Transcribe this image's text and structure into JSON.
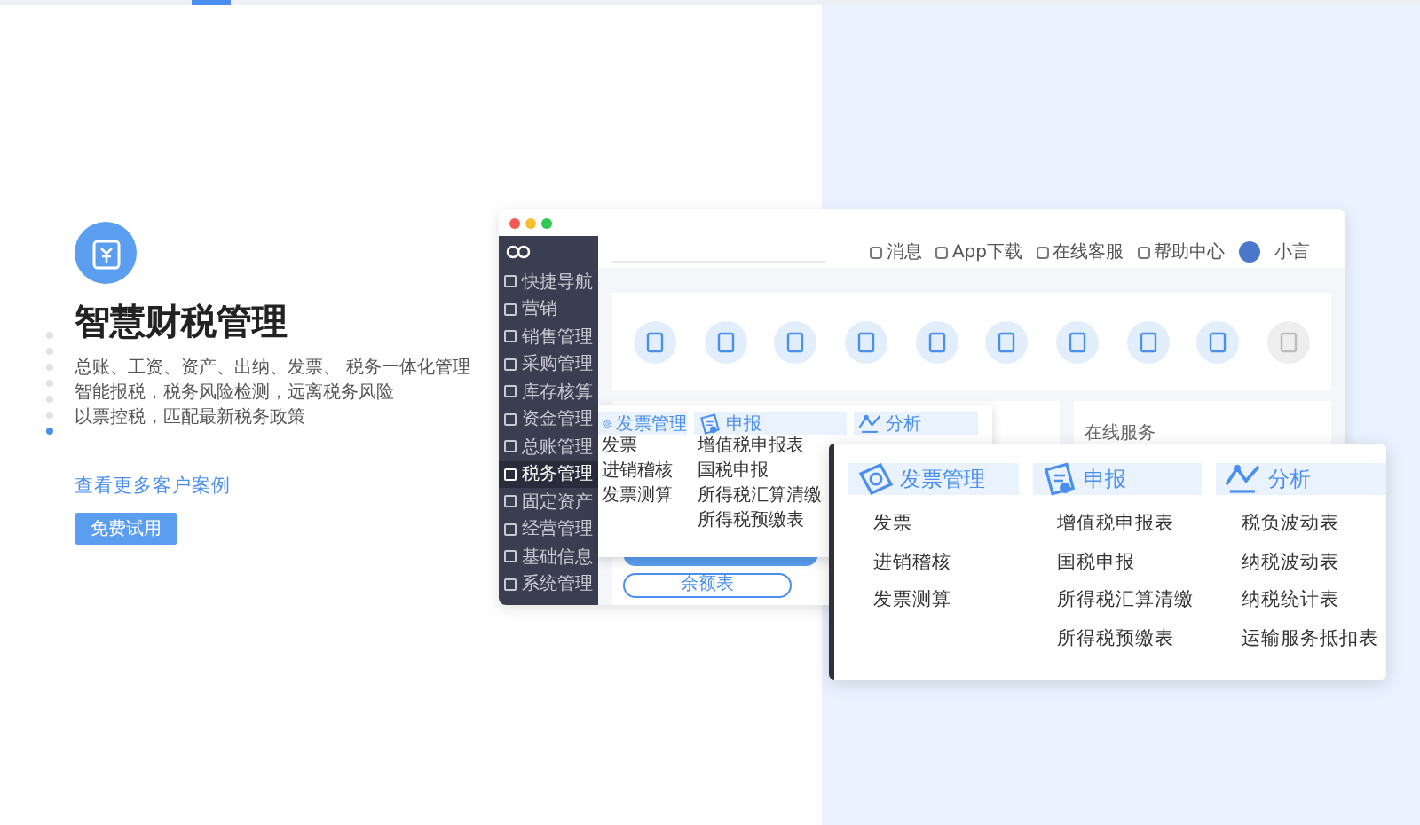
{
  "hero": {
    "title": "智慧财税管理",
    "lines": [
      "总账、工资、资产、出纳、发票、 税务一体化管理",
      "智能报税，税务风险检测，远离税务风险",
      "以票控税，匹配最新税务政策"
    ],
    "link": "查看更多客户案例",
    "button": "免费试用"
  },
  "slides": [
    {
      "selected": false
    },
    {
      "selected": false
    },
    {
      "selected": false
    },
    {
      "selected": false
    },
    {
      "selected": false
    },
    {
      "selected": false
    },
    {
      "selected": true
    }
  ],
  "app": {
    "header": [
      "消息",
      "App下载",
      "在线客服",
      "帮助中心"
    ],
    "user": "小言",
    "sidebar": [
      {
        "label": "快捷导航",
        "selected": false
      },
      {
        "label": "营销",
        "selected": false
      },
      {
        "label": "销售管理",
        "selected": false
      },
      {
        "label": "采购管理",
        "selected": false
      },
      {
        "label": "库存核算",
        "selected": false
      },
      {
        "label": "资金管理",
        "selected": false
      },
      {
        "label": "总账管理",
        "selected": false
      },
      {
        "label": "税务管理",
        "selected": true
      },
      {
        "label": "固定资产",
        "selected": false
      },
      {
        "label": "经营管理",
        "selected": false
      },
      {
        "label": "基础信息",
        "selected": false
      },
      {
        "label": "系统管理",
        "selected": false
      }
    ],
    "service_title": "在线服务",
    "ledger_button": "余额表",
    "menu": [
      {
        "title": "发票管理",
        "items": [
          "发票",
          "进销稽核",
          "发票测算"
        ]
      },
      {
        "title": "申报",
        "items": [
          "增值税申报表",
          "国税申报",
          "所得税汇算清缴",
          "所得税预缴表"
        ]
      },
      {
        "title": "分析"
      }
    ]
  },
  "popup": [
    {
      "title": "发票管理",
      "items": [
        "发票",
        "进销稽核",
        "发票测算"
      ]
    },
    {
      "title": "申报",
      "items": [
        "增值税申报表",
        "国税申报",
        "所得税汇算清缴",
        "所得税预缴表"
      ]
    },
    {
      "title": "分析",
      "items": [
        "税负波动表",
        "纳税波动表",
        "纳税统计表",
        "运输服务抵扣表"
      ]
    }
  ]
}
